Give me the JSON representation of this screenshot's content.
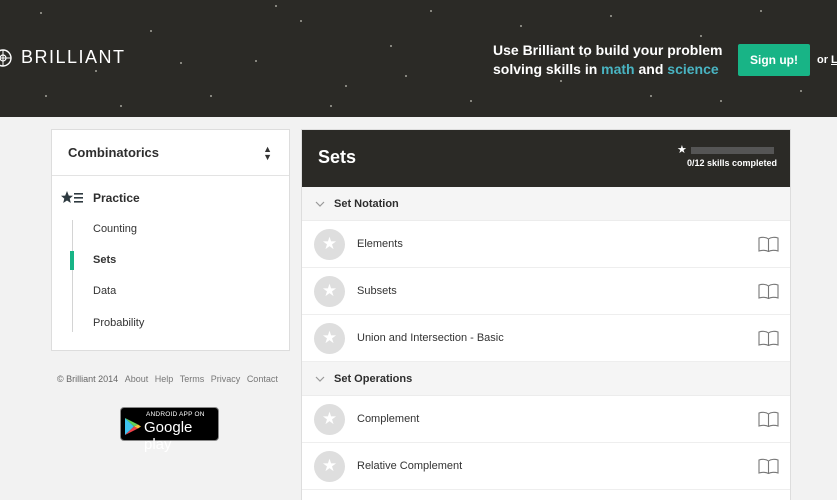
{
  "header": {
    "brand": "BRILLIANT",
    "promo_line1": "Use Brilliant to build your problem",
    "promo_line2_pre": "solving skills in",
    "promo_math": "math",
    "promo_and": "and",
    "promo_science": "science",
    "signup_label": "Sign up!",
    "or_label": "or",
    "login_label": "L",
    "accent": "#18b486",
    "link_color": "#49b4c2"
  },
  "sidebar": {
    "topic": "Combinatorics",
    "practice_label": "Practice",
    "items": [
      {
        "label": "Counting",
        "active": false
      },
      {
        "label": "Sets",
        "active": true
      },
      {
        "label": "Data",
        "active": false
      },
      {
        "label": "Probability",
        "active": false
      }
    ]
  },
  "footer": {
    "copyright": "© Brilliant 2014",
    "links": [
      "About",
      "Help",
      "Terms",
      "Privacy",
      "Contact"
    ],
    "app_badge_small": "ANDROID APP ON",
    "app_badge_big": "Google play"
  },
  "main": {
    "title": "Sets",
    "progress_text": "0/12 skills completed",
    "progress_fraction": 0,
    "sections": [
      {
        "label": "Set Notation",
        "skills": [
          "Elements",
          "Subsets",
          "Union and Intersection - Basic"
        ]
      },
      {
        "label": "Set Operations",
        "skills": [
          "Complement",
          "Relative Complement"
        ]
      }
    ]
  }
}
